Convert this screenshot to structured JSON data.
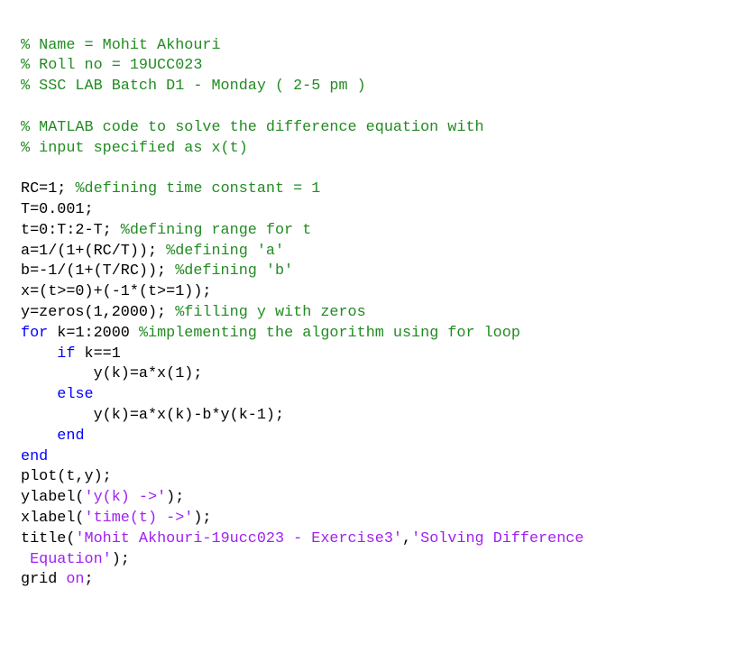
{
  "editor": {
    "lines": [
      [
        {
          "t": "comment",
          "v": "% Name = Mohit Akhouri"
        }
      ],
      [
        {
          "t": "comment",
          "v": "% Roll no = 19UCC023"
        }
      ],
      [
        {
          "t": "comment",
          "v": "% SSC LAB Batch D1 - Monday ( 2-5 pm )"
        }
      ],
      [],
      [
        {
          "t": "comment",
          "v": "% MATLAB code to solve the difference equation with"
        }
      ],
      [
        {
          "t": "comment",
          "v": "% input specified as x(t)"
        }
      ],
      [],
      [
        {
          "t": "plain",
          "v": "RC=1; "
        },
        {
          "t": "comment",
          "v": "%defining time constant = 1"
        }
      ],
      [
        {
          "t": "plain",
          "v": "T=0.001;"
        }
      ],
      [
        {
          "t": "plain",
          "v": "t=0:T:2-T; "
        },
        {
          "t": "comment",
          "v": "%defining range for t"
        }
      ],
      [
        {
          "t": "plain",
          "v": "a=1/(1+(RC/T)); "
        },
        {
          "t": "comment",
          "v": "%defining 'a'"
        }
      ],
      [
        {
          "t": "plain",
          "v": "b=-1/(1+(T/RC)); "
        },
        {
          "t": "comment",
          "v": "%defining 'b'"
        }
      ],
      [
        {
          "t": "plain",
          "v": "x=(t>=0)+(-1*(t>=1));"
        }
      ],
      [
        {
          "t": "plain",
          "v": "y=zeros(1,2000); "
        },
        {
          "t": "comment",
          "v": "%filling y with zeros"
        }
      ],
      [
        {
          "t": "keyword",
          "v": "for "
        },
        {
          "t": "plain",
          "v": "k=1:2000 "
        },
        {
          "t": "comment",
          "v": "%implementing the algorithm using for loop"
        }
      ],
      [
        {
          "t": "plain",
          "v": "    "
        },
        {
          "t": "keyword",
          "v": "if "
        },
        {
          "t": "plain",
          "v": "k==1"
        }
      ],
      [
        {
          "t": "plain",
          "v": "        y(k)=a*x(1);"
        }
      ],
      [
        {
          "t": "plain",
          "v": "    "
        },
        {
          "t": "keyword",
          "v": "else"
        }
      ],
      [
        {
          "t": "plain",
          "v": "        y(k)=a*x(k)-b*y(k-1);"
        }
      ],
      [
        {
          "t": "plain",
          "v": "    "
        },
        {
          "t": "keyword",
          "v": "end"
        }
      ],
      [
        {
          "t": "keyword",
          "v": "end"
        }
      ],
      [
        {
          "t": "plain",
          "v": "plot(t,y);"
        }
      ],
      [
        {
          "t": "plain",
          "v": "ylabel("
        },
        {
          "t": "string",
          "v": "'y(k) ->'"
        },
        {
          "t": "plain",
          "v": ");"
        }
      ],
      [
        {
          "t": "plain",
          "v": "xlabel("
        },
        {
          "t": "string",
          "v": "'time(t) ->'"
        },
        {
          "t": "plain",
          "v": ");"
        }
      ],
      [
        {
          "t": "plain",
          "v": "title("
        },
        {
          "t": "string",
          "v": "'Mohit Akhouri-19ucc023 - Exercise3'"
        },
        {
          "t": "plain",
          "v": ","
        },
        {
          "t": "string",
          "v": "'Solving Difference"
        }
      ],
      [
        {
          "t": "string",
          "v": " Equation'"
        },
        {
          "t": "plain",
          "v": ");"
        }
      ],
      [
        {
          "t": "plain",
          "v": "grid "
        },
        {
          "t": "string",
          "v": "on"
        },
        {
          "t": "plain",
          "v": ";"
        }
      ]
    ]
  },
  "colors": {
    "comment": "#228b22",
    "keyword": "#0000ff",
    "string": "#a020f0",
    "plain": "#000000",
    "background": "#ffffff"
  }
}
